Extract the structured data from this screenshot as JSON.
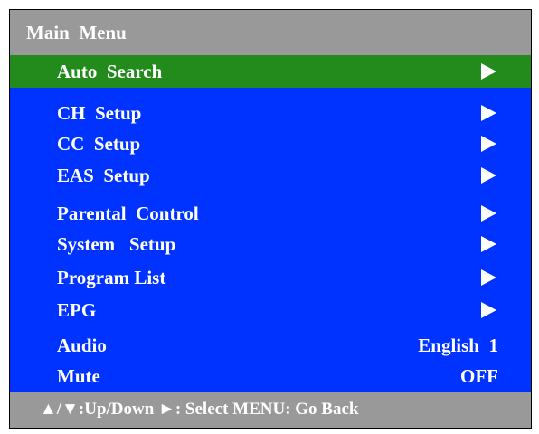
{
  "header": {
    "title": "Main  Menu"
  },
  "menu": {
    "items": [
      {
        "label": "Auto  Search"
      },
      {
        "label": "CH  Setup"
      },
      {
        "label": "CC  Setup"
      },
      {
        "label": "EAS  Setup"
      },
      {
        "label": "Parental  Control"
      },
      {
        "label": "System   Setup"
      },
      {
        "label": "Program List"
      },
      {
        "label": "EPG"
      },
      {
        "label": "Audio",
        "value": "English  1"
      },
      {
        "label": "Mute",
        "value": "OFF"
      }
    ],
    "selected_index": 0
  },
  "footer": {
    "hint": "▲/▼:Up/Down ►: Select MENU: Go Back"
  },
  "colors": {
    "header_bg": "#999999",
    "body_bg": "#0033ff",
    "selected_bg": "#228b1c",
    "text": "#ffffff"
  }
}
